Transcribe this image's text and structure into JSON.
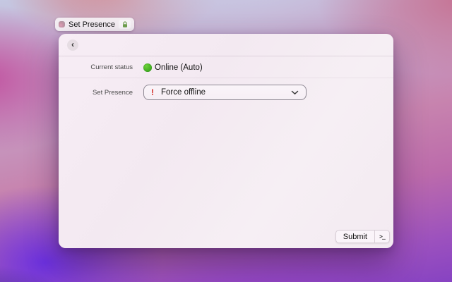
{
  "floating_tab": {
    "title": "Set Presence",
    "icons": {
      "app_icon": "app-glyph",
      "lock_icon": "green-lock",
      "lock_color": "#6fa14e"
    }
  },
  "panel": {
    "header": {
      "back_glyph": "‹"
    },
    "status_row": {
      "label": "Current status",
      "value": "Online (Auto)",
      "status_color": "#3fae1f",
      "status_icon": "green-dot"
    },
    "presence_row": {
      "label": "Set Presence",
      "warning_glyph": "!",
      "warning_color": "#d22d26",
      "selected_option": "Force offline",
      "chevron_icon": "chevron-down"
    },
    "footer": {
      "submit_label": "Submit",
      "terminal_glyph": ">_"
    }
  }
}
